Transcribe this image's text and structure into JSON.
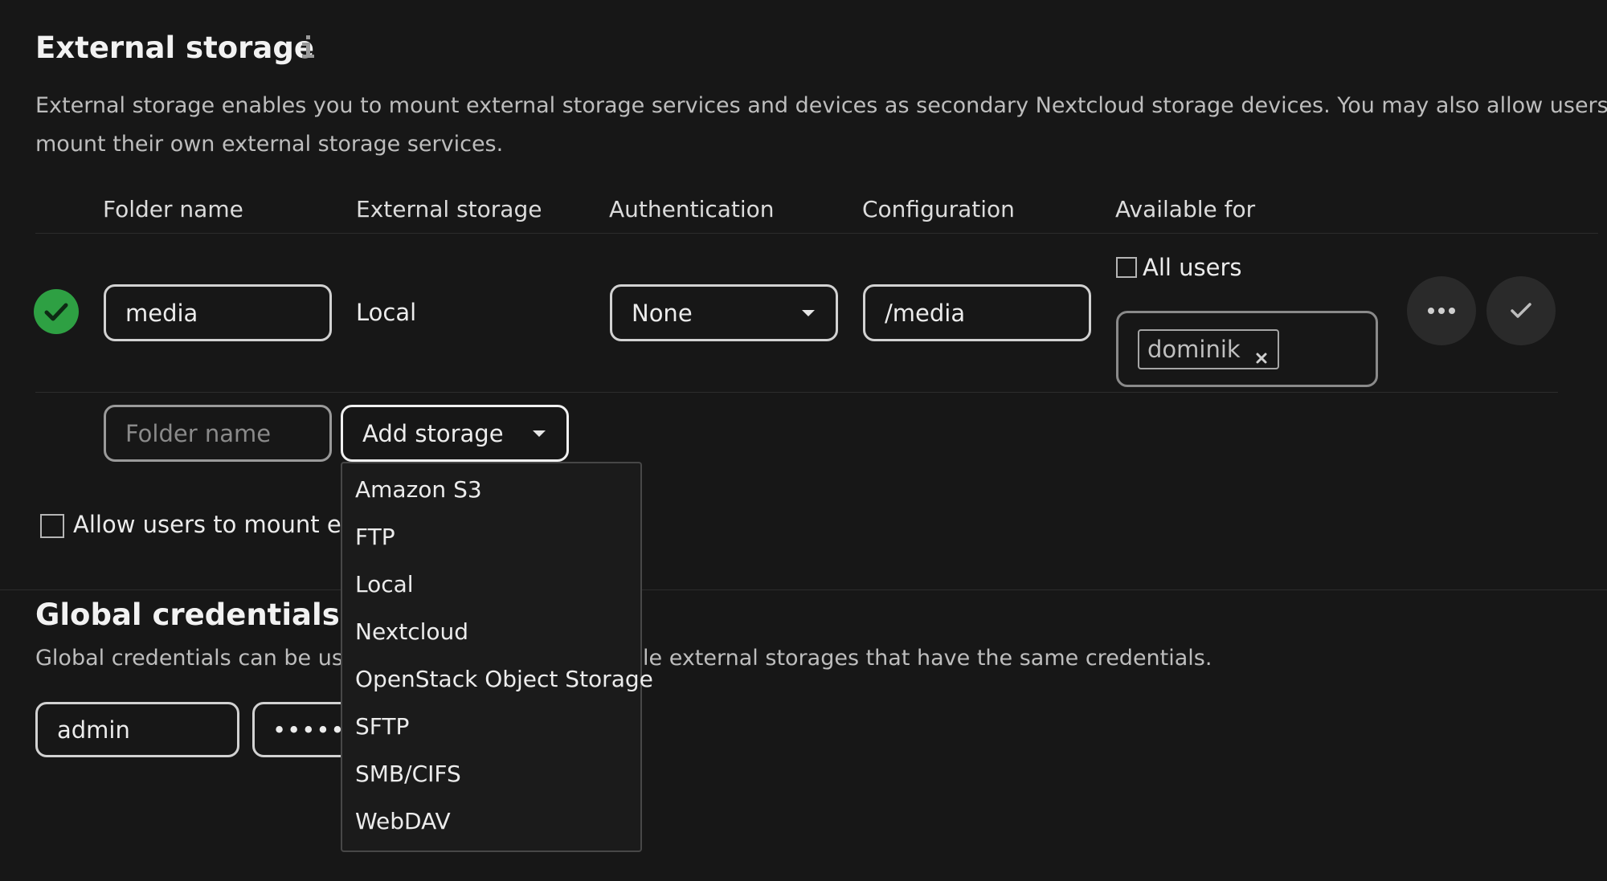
{
  "external_storage": {
    "title": "External storage",
    "info_icon": "info-icon",
    "description_line1": "External storage enables you to mount external storage services and devices as secondary Nextcloud storage devices. You may also allow users to",
    "description_line2": "mount their own external storage services.",
    "columns": {
      "folder_name": "Folder name",
      "external_storage": "External storage",
      "authentication": "Authentication",
      "configuration": "Configuration",
      "available_for": "Available for"
    },
    "mount": {
      "status_icon": "check-circle-icon",
      "folder_name": "media",
      "storage_type": "Local",
      "authentication": "None",
      "configuration": "/media",
      "all_users_label": "All users",
      "all_users_checked": false,
      "user_tag": "dominik"
    },
    "new_row": {
      "folder_name_placeholder": "Folder name",
      "add_storage_label": "Add storage"
    },
    "allow_users_label": "Allow users to mount exte",
    "storage_options": [
      "Amazon S3",
      "FTP",
      "Local",
      "Nextcloud",
      "OpenStack Object Storage",
      "SFTP",
      "SMB/CIFS",
      "WebDAV"
    ]
  },
  "global_credentials": {
    "title": "Global credentials",
    "description_left": "Global credentials can be use",
    "description_right": "le external storages that have the same credentials.",
    "username": "admin",
    "password_mask": "•••••"
  },
  "colors": {
    "accent_green": "#2ea043",
    "background": "#171717"
  }
}
